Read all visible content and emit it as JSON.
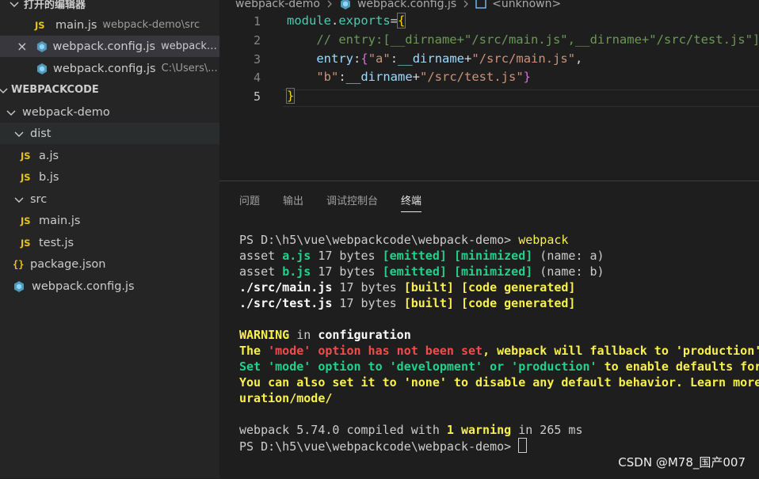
{
  "sidebar": {
    "open_editors_title": "打开的编辑器",
    "open_editors": [
      {
        "name": "main.js",
        "desc": "webpack-demo\\src"
      },
      {
        "name": "webpack.config.js",
        "desc": "webpack-..."
      },
      {
        "name": "webpack.config.js",
        "desc": "C:\\Users\\..."
      }
    ],
    "workspace_title": "WEBPACKCODE",
    "tree": {
      "root": "webpack-demo",
      "dist": "dist",
      "dist_a": "a.js",
      "dist_b": "b.js",
      "src": "src",
      "src_main": "main.js",
      "src_test": "test.js",
      "package": "package.json",
      "config": "webpack.config.js"
    },
    "icons": {
      "js_label": "JS",
      "braces_label": "{}",
      "close": "×"
    }
  },
  "editor": {
    "breadcrumb": [
      "webpack-demo",
      "webpack.config.js",
      "<unknown>"
    ],
    "line_numbers": [
      "1",
      "2",
      "3",
      "4",
      "5"
    ],
    "lines": {
      "l1_a": "module",
      "l1_b": ".",
      "l1_c": "exports",
      "l1_d": "=",
      "l1_e": "{",
      "l2": "    // entry:[__dirname+\"/src/main.js\",__dirname+\"/src/test.js\"],",
      "l3_indent": "    ",
      "l3_a": "entry",
      "l3_b": ":",
      "l3_c": "{",
      "l3_d": "\"a\"",
      "l3_e": ":",
      "l3_f": "__dirname",
      "l3_g": "+",
      "l3_h": "\"/src/main.js\"",
      "l3_i": ",",
      "l4_indent": "    ",
      "l4_a": "\"b\"",
      "l4_b": ":",
      "l4_c": "__dirname",
      "l4_d": "+",
      "l4_e": "\"/src/test.js\"",
      "l4_f": "}",
      "l5": "}"
    }
  },
  "panel": {
    "tabs": [
      "问题",
      "输出",
      "调试控制台",
      "终端"
    ],
    "terminal": {
      "l1_prompt": "PS D:\\h5\\vue\\webpackcode\\webpack-demo> ",
      "l1_cmd": "webpack",
      "asset": "asset ",
      "a_file": "a.js",
      "b_file": "b.js",
      "bytes": " 17 bytes ",
      "emitted": "[emitted]",
      "minimized": "[minimized]",
      "name_a": " (name: a)",
      "name_b": " (name: b)",
      "main_mod": "./src/main.js",
      "test_mod": "./src/test.js",
      "built": "[built]",
      "codegen": "[code generated]",
      "warn_word": "WARNING",
      "warn_in": " in ",
      "warn_cfg": "configuration",
      "l7_a": "The ",
      "l7_b": "'mode' option has not been set",
      "l7_c": ", webpack will fallback to 'production'",
      "l8_a": "Set 'mode' option to 'development' or 'production'",
      "l8_b": " to enable defaults for",
      "l9": "You can also set it to 'none' to disable any default behavior. Learn more",
      "l10": "uration/mode/",
      "l11_a": "webpack 5.74.0 compiled with ",
      "l11_b": "1 warning",
      "l11_c": " in 265 ms",
      "l12_prompt": "PS D:\\h5\\vue\\webpackcode\\webpack-demo> "
    }
  },
  "watermark": "CSDN @M78_国产007",
  "colors": {
    "js_icon": "#e8c31e",
    "config_icon": "#519aba",
    "terminal_green": "#23d18b",
    "terminal_yellow": "#f9f14b",
    "terminal_red": "#f14c4c"
  }
}
